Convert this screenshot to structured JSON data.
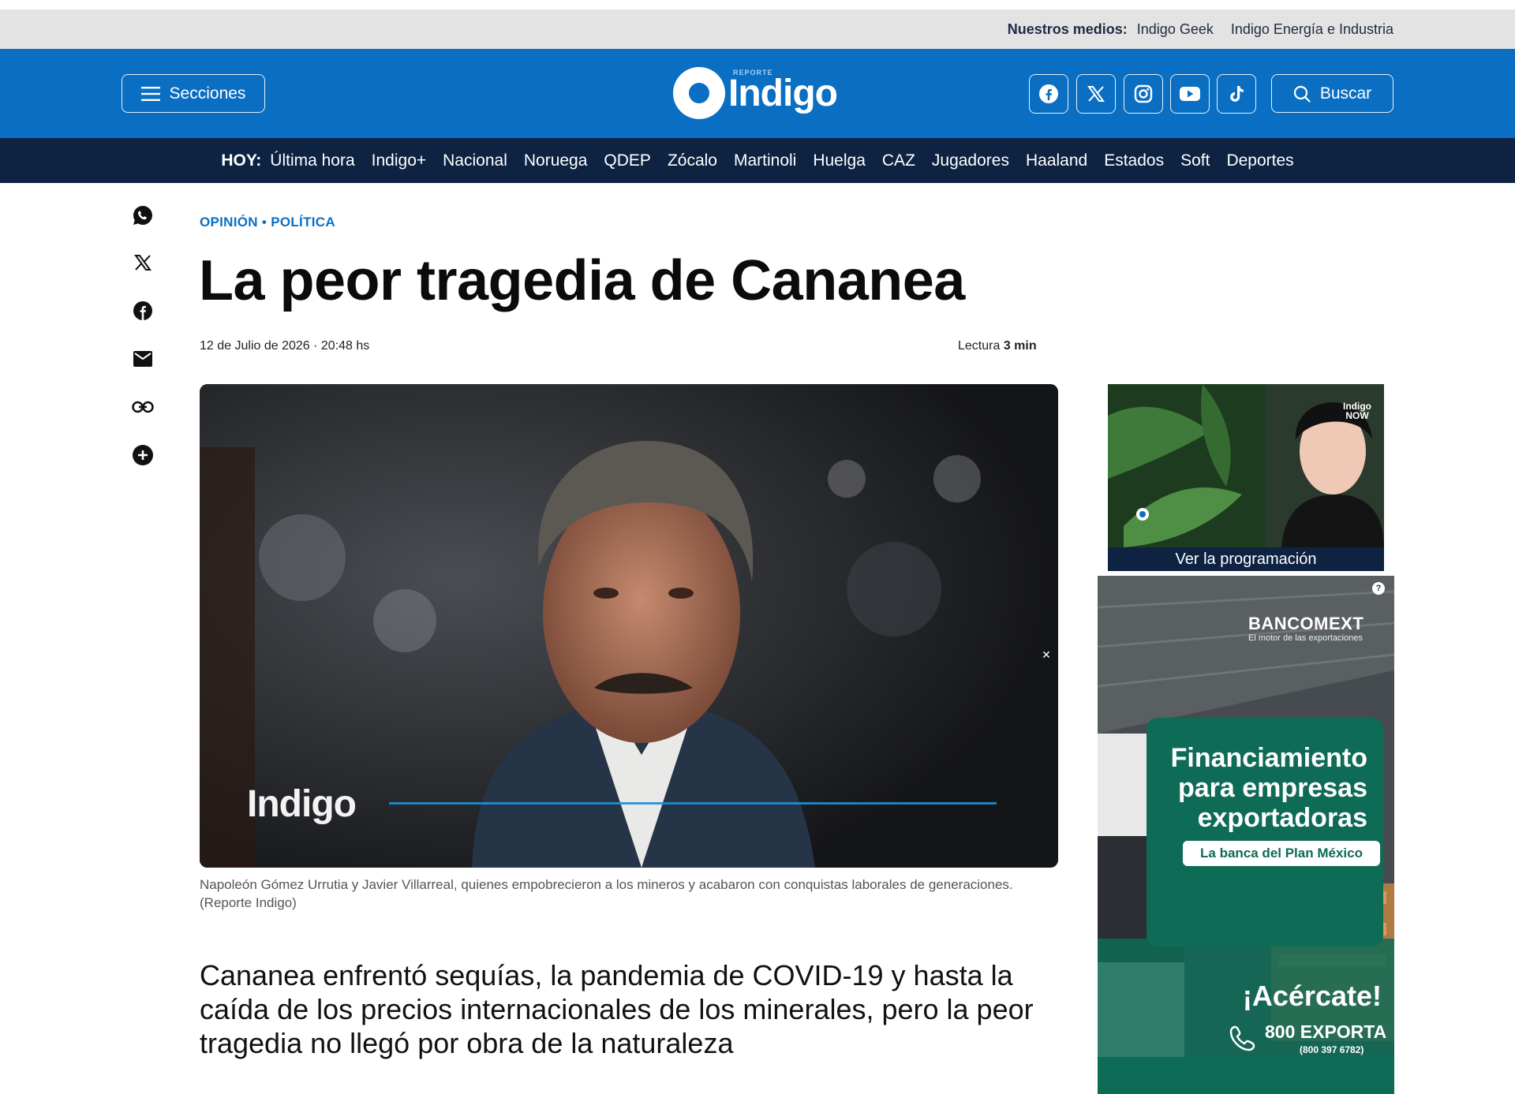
{
  "topbar": {
    "label": "Nuestros medios:",
    "links": [
      "Indigo Geek",
      "Indigo Energía e Industria"
    ]
  },
  "header": {
    "sections_label": "Secciones",
    "search_label": "Buscar",
    "logo_text": "Indigo",
    "logo_small": "REPORTE",
    "social_icons": [
      "facebook-icon",
      "x-icon",
      "instagram-icon",
      "youtube-icon",
      "tiktok-icon"
    ]
  },
  "nav": {
    "today_label": "HOY:",
    "items": [
      "Última hora",
      "Indigo+",
      "Nacional",
      "Noruega",
      "QDEP",
      "Zócalo",
      "Martinoli",
      "Huelga",
      "CAZ",
      "Jugadores",
      "Haaland",
      "Estados",
      "Soft",
      "Deportes"
    ]
  },
  "share_icons": [
    "whatsapp-icon",
    "x-icon",
    "facebook-icon",
    "email-icon",
    "link-icon",
    "plus-icon"
  ],
  "article": {
    "kicker_section": "OPINIÓN",
    "kicker_sep": " • ",
    "kicker_topic": "POLÍTICA",
    "title": "La peor tragedia de Cananea",
    "date": "12 de Julio de 2026",
    "date_sep": " · ",
    "time": "20:48 hs",
    "reading_label": "Lectura ",
    "reading_time": "3 min",
    "image_watermark": "Indigo",
    "caption": "Napoleón Gómez Urrutia y Javier Villarreal, quienes empobrecieron a los mineros y acabaron con conquistas laborales de generaciones. (Reporte Indigo)",
    "lead": "Cananea enfrentó sequías, la pandemia de COVID-19 y hasta la caída de los precios internacionales de los minerales, pero la peor tragedia no llegó por obra de la naturaleza"
  },
  "video_promo": {
    "badge": "Indigo NOW",
    "label": "Ver la programación"
  },
  "ad": {
    "brand": "BANCOMEXT",
    "brand_tagline": "El motor de las exportaciones",
    "headline": "Financiamiento para empresas exportadoras",
    "pill": "La banca del Plan México",
    "cta": "¡Acércate!",
    "phone": "800 EXPORTA",
    "phone_number": "(800 397 6782)",
    "info": "?"
  },
  "colors": {
    "brand_blue": "#0a6fc2",
    "nav_dark": "#0e2242",
    "ad_green": "#0e6b56"
  }
}
